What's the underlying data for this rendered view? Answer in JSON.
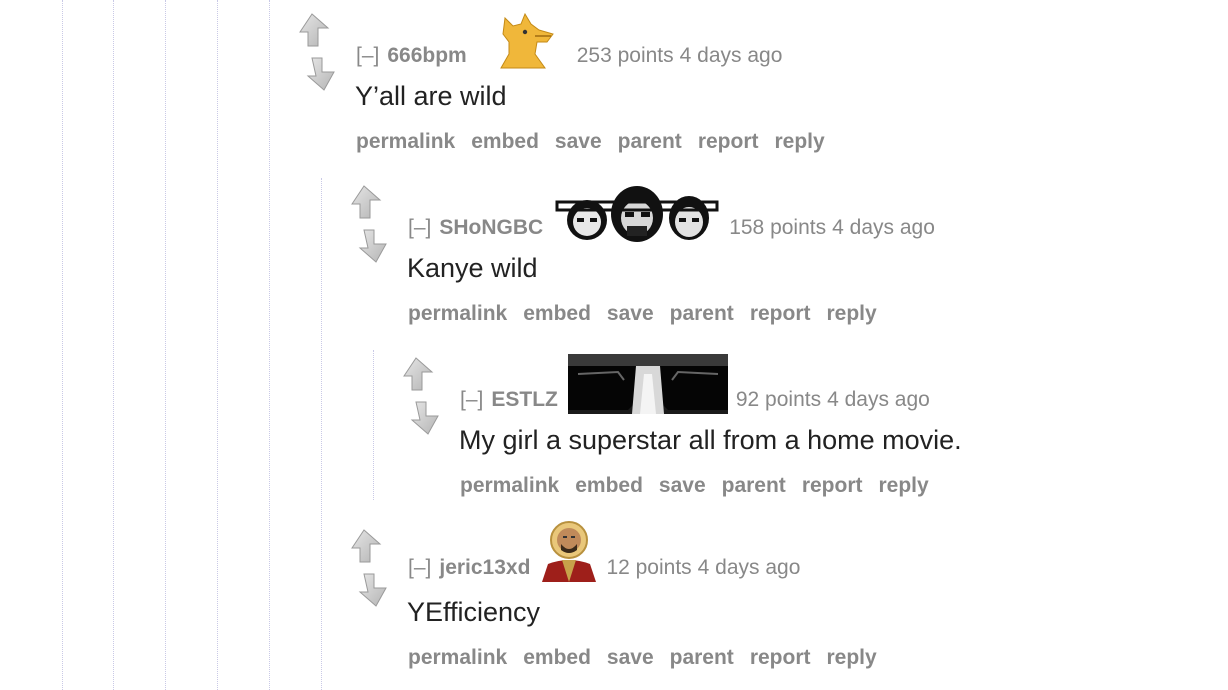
{
  "actions": {
    "permalink": "permalink",
    "embed": "embed",
    "save": "save",
    "parent": "parent",
    "report": "report",
    "reply": "reply"
  },
  "comments": [
    {
      "toggle": "[–]",
      "author": "666bpm",
      "flair": "yellow-fox-avatar",
      "points": "253 points",
      "age": "4 days ago",
      "body": "Y’all are wild"
    },
    {
      "toggle": "[–]",
      "author": "SHoNGBC",
      "flair": "three-faces-flair",
      "points": "158 points",
      "age": "4 days ago",
      "body": "Kanye wild"
    },
    {
      "toggle": "[–]",
      "author": "ESTLZ",
      "flair": "sunglasses-face-flair",
      "points": "92 points",
      "age": "4 days ago",
      "body": "My girl a superstar all from a home movie."
    },
    {
      "toggle": "[–]",
      "author": "jeric13xd",
      "flair": "saint-portrait-flair",
      "points": "12 points",
      "age": "4 days ago",
      "body": "YEfficiency"
    }
  ],
  "colors": {
    "meta_gray": "#888888",
    "body_text": "#222222",
    "thread_line": "#c9c9e6"
  }
}
